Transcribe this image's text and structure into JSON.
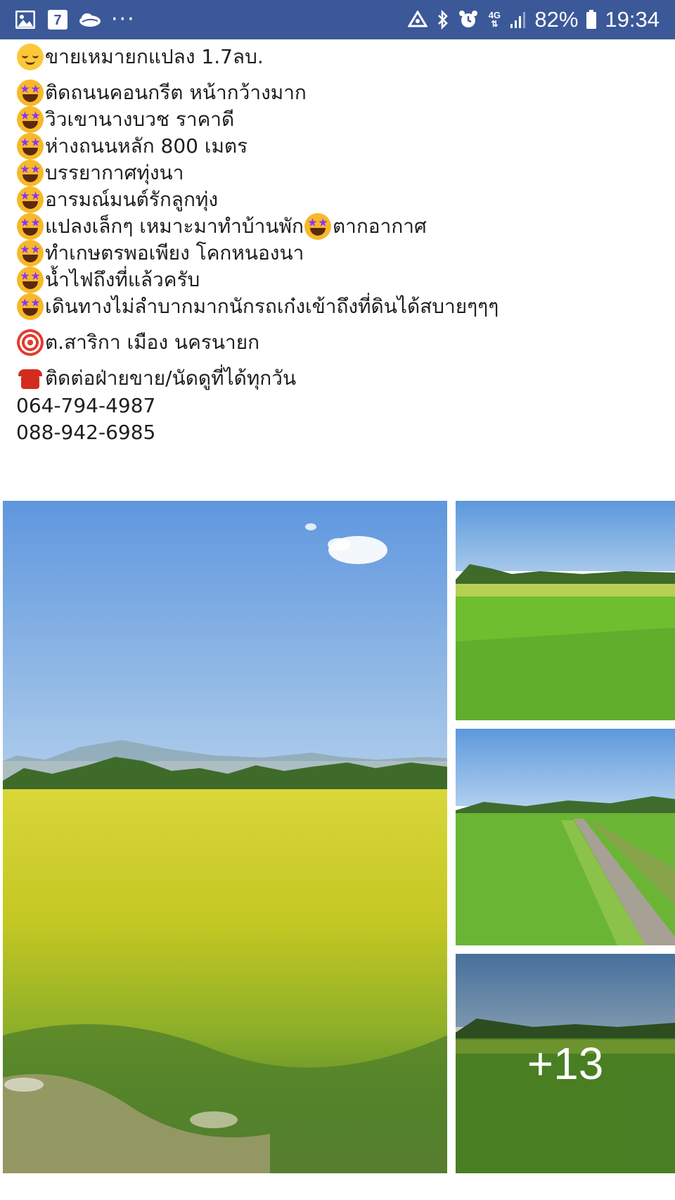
{
  "status_bar": {
    "left_icons": [
      "gallery-icon",
      "seven-eleven-icon",
      "cloud-icon",
      "more-dots-icon"
    ],
    "more_dots": "···",
    "right_icons": [
      "recycle-icon",
      "bluetooth-icon",
      "alarm-icon",
      "network-4g-icon",
      "signal-icon",
      "battery-icon"
    ],
    "network": "4G",
    "battery": "82%",
    "time": "19:34",
    "bg_color": "#3b5998"
  },
  "post": {
    "headline": "ขายเหมายกแปลง 1.7ลบ.",
    "features": [
      "ติดถนนคอนกรีต หน้ากว้างมาก",
      "วิวเขานางบวช ราคาดี",
      "ห่างถนนหลัก 800 เมตร",
      "บรรยากาศทุ่งนา",
      "อารมณ์มนต์รักลูกทุ่ง",
      "แปลงเล็กๆ เหมาะมาทำบ้านพัก",
      "ทำเกษตรพอเพียง โคกหนองนา",
      "น้ำไฟถึงที่แล้วครับ",
      "เดินทางไม่ลำบากมากนักรถเก๋งเข้าถึงที่ดินได้สบายๆๆๆ"
    ],
    "feature_6_suffix": "ตากอากาศ",
    "location": "ต.สาริกา เมือง นครนายก",
    "contact_label": "ติดต่อฝ่ายขาย/นัดดูที่ได้ทุกวัน",
    "phones": [
      "064-794-4987",
      "088-942-6985"
    ]
  },
  "photos": {
    "more_count": "+13"
  }
}
